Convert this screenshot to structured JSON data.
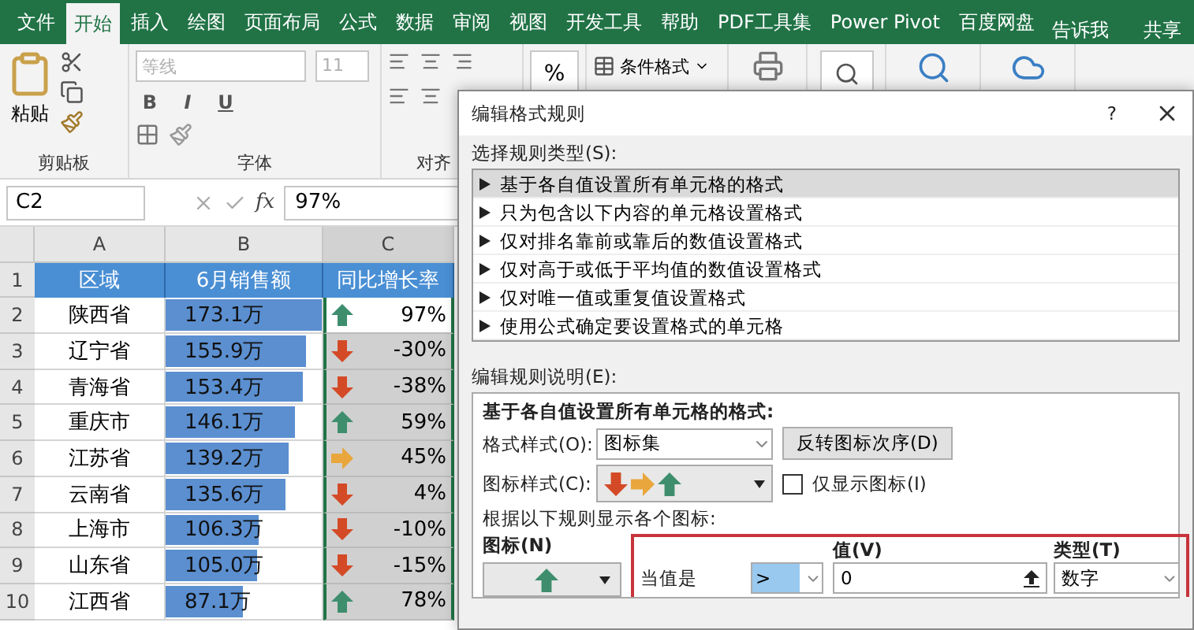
{
  "ribbon_tabs": [
    {
      "label": "文件",
      "selected": false
    },
    {
      "label": "开始",
      "selected": true
    },
    {
      "label": "插入",
      "selected": false
    },
    {
      "label": "绘图",
      "selected": false
    },
    {
      "label": "页面布局",
      "selected": false
    },
    {
      "label": "公式",
      "selected": false
    },
    {
      "label": "数据",
      "selected": false
    },
    {
      "label": "审阅",
      "selected": false
    },
    {
      "label": "视图",
      "selected": false
    },
    {
      "label": "开发工具",
      "selected": false
    },
    {
      "label": "帮助",
      "selected": false
    },
    {
      "label": "PDF工具集",
      "selected": false
    },
    {
      "label": "Power Pivot",
      "selected": false
    },
    {
      "label": "百度网盘",
      "selected": false
    }
  ],
  "tell_me": "告诉我",
  "share": "共享",
  "clipboard": {
    "paste": "粘贴",
    "label": "剪贴板"
  },
  "font": {
    "name": "等线",
    "size": "11",
    "disabled": true,
    "buttons": [
      "B",
      "I",
      "U"
    ],
    "label": "字体"
  },
  "alignment": {
    "label": "对齐"
  },
  "number": {
    "symbol": "%"
  },
  "styles": {
    "conditional_formatting": "条件格式"
  },
  "formula_bar": {
    "name_box": "C2",
    "fx": "fx",
    "value": "97%"
  },
  "sheet": {
    "columns": [
      {
        "label": "A",
        "selected": false
      },
      {
        "label": "B",
        "selected": false
      },
      {
        "label": "C",
        "selected": true
      }
    ],
    "header_row": {
      "number": "1",
      "cells": [
        "区域",
        "6月销售额",
        "同比增长率"
      ]
    },
    "rows": [
      {
        "number": "2",
        "region": "陕西省",
        "sales": "173.1万",
        "level": 1.0,
        "kind": "up",
        "growth": "97%",
        "active": true
      },
      {
        "number": "3",
        "region": "辽宁省",
        "sales": "155.9万",
        "level": 0.9,
        "kind": "down",
        "growth": "-30%",
        "active": false
      },
      {
        "number": "4",
        "region": "青海省",
        "sales": "153.4万",
        "level": 0.88,
        "kind": "down",
        "growth": "-38%",
        "active": false
      },
      {
        "number": "5",
        "region": "重庆市",
        "sales": "146.1万",
        "level": 0.83,
        "kind": "up",
        "growth": "59%",
        "active": false
      },
      {
        "number": "6",
        "region": "江苏省",
        "sales": "139.2万",
        "level": 0.79,
        "kind": "right",
        "growth": "45%",
        "active": false
      },
      {
        "number": "7",
        "region": "云南省",
        "sales": "135.6万",
        "level": 0.77,
        "kind": "down",
        "growth": "4%",
        "active": false
      },
      {
        "number": "8",
        "region": "上海市",
        "sales": "106.3万",
        "level": 0.6,
        "kind": "down",
        "growth": "-10%",
        "active": false
      },
      {
        "number": "9",
        "region": "山东省",
        "sales": "105.0万",
        "level": 0.59,
        "kind": "down",
        "growth": "-15%",
        "active": false
      },
      {
        "number": "10",
        "region": "江西省",
        "sales": "87.1万",
        "level": 0.49,
        "kind": "up",
        "growth": "78%",
        "active": false
      }
    ]
  },
  "dialog": {
    "title": "编辑格式规则",
    "help": "?",
    "rule_type_label": "选择规则类型(S):",
    "rule_types": [
      {
        "label": "基于各自值设置所有单元格的格式",
        "selected": true
      },
      {
        "label": "只为包含以下内容的单元格设置格式",
        "selected": false
      },
      {
        "label": "仅对排名靠前或靠后的数值设置格式",
        "selected": false
      },
      {
        "label": "仅对高于或低于平均值的数值设置格式",
        "selected": false
      },
      {
        "label": "仅对唯一值或重复值设置格式",
        "selected": false
      },
      {
        "label": "使用公式确定要设置格式的单元格",
        "selected": false
      }
    ],
    "description_label": "编辑规则说明(E):",
    "description": {
      "heading": "基于各自值设置所有单元格的格式:",
      "format_style_label": "格式样式(O):",
      "format_style": "图标集",
      "reverse_button": "反转图标次序(D)",
      "icon_style_label": "图标样式(C):",
      "icon_style": [
        {
          "kind": "down"
        },
        {
          "kind": "right"
        },
        {
          "kind": "up"
        }
      ],
      "show_icon_only": {
        "label": "仅显示图标(I)",
        "checked": false
      },
      "rules_label": "根据以下规则显示各个图标:",
      "icon_header": "图标(N)",
      "value_header": "值(V)",
      "type_header": "类型(T)",
      "rules": [
        {
          "kind": "up",
          "condition": "当值是",
          "operator": ">",
          "value": "0",
          "type": "数字"
        }
      ]
    }
  }
}
